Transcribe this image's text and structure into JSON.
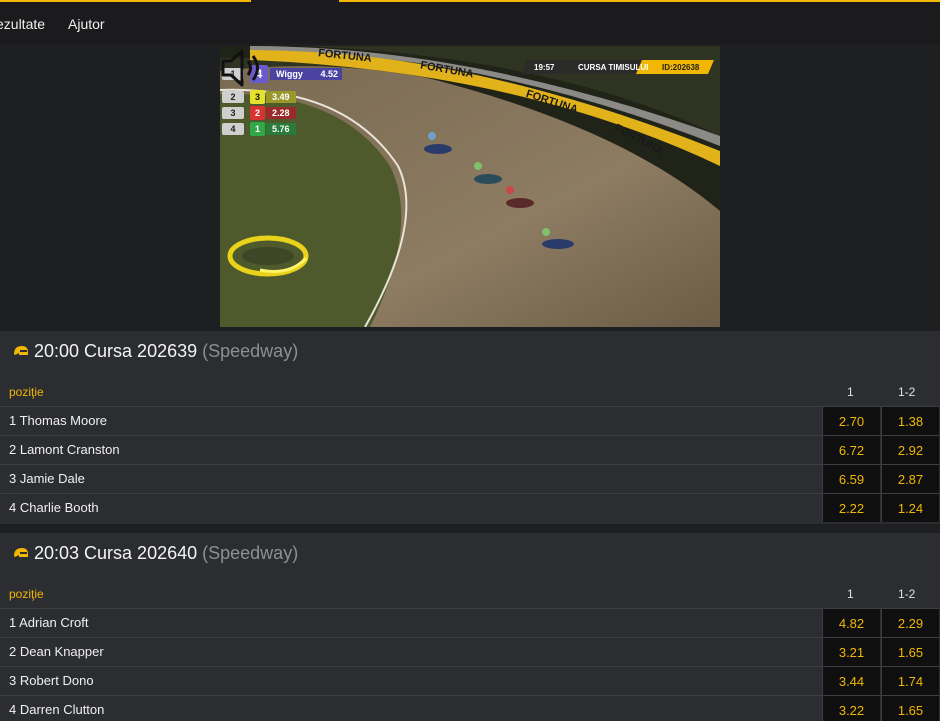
{
  "nav": {
    "rezultate": "ezultate",
    "ajutor": "Ajutor"
  },
  "video": {
    "hud": [
      {
        "pos": "1",
        "num": "4",
        "name": "Wiggy",
        "odd": "4.52",
        "color": "#6a5acd"
      },
      {
        "pos": "2",
        "num": "3",
        "odd": "3.49",
        "color": "#e6e12a"
      },
      {
        "pos": "3",
        "num": "2",
        "odd": "2.28",
        "color": "#d93232"
      },
      {
        "pos": "4",
        "num": "1",
        "odd": "5.76",
        "color": "#2fa84a"
      }
    ],
    "clock": "19:57",
    "event_name": "CURSA TIMISULUI",
    "event_id": "ID:202638",
    "banner": "FORTUNA",
    "volume_icon": "speaker-icon"
  },
  "races": [
    {
      "time_title": "20:00 Cursa 202639",
      "sport": "(Speedway)",
      "col_label": "poziţie",
      "col1": "1",
      "col2": "1-2",
      "runners": [
        {
          "name": "1 Thomas Moore",
          "o1": "2.70",
          "o2": "1.38"
        },
        {
          "name": "2 Lamont Cranston",
          "o1": "6.72",
          "o2": "2.92"
        },
        {
          "name": "3 Jamie Dale",
          "o1": "6.59",
          "o2": "2.87"
        },
        {
          "name": "4 Charlie Booth",
          "o1": "2.22",
          "o2": "1.24"
        }
      ]
    },
    {
      "time_title": "20:03 Cursa 202640",
      "sport": "(Speedway)",
      "col_label": "poziţie",
      "col1": "1",
      "col2": "1-2",
      "runners": [
        {
          "name": "1 Adrian Croft",
          "o1": "4.82",
          "o2": "2.29"
        },
        {
          "name": "2 Dean Knapper",
          "o1": "3.21",
          "o2": "1.65"
        },
        {
          "name": "3 Robert Dono",
          "o1": "3.44",
          "o2": "1.74"
        },
        {
          "name": "4 Darren Clutton",
          "o1": "3.22",
          "o2": "1.65"
        }
      ]
    }
  ],
  "colors": {
    "accent": "#f2b705",
    "odds_bg": "#0f0f10",
    "panel_bg": "#2b2d31"
  }
}
